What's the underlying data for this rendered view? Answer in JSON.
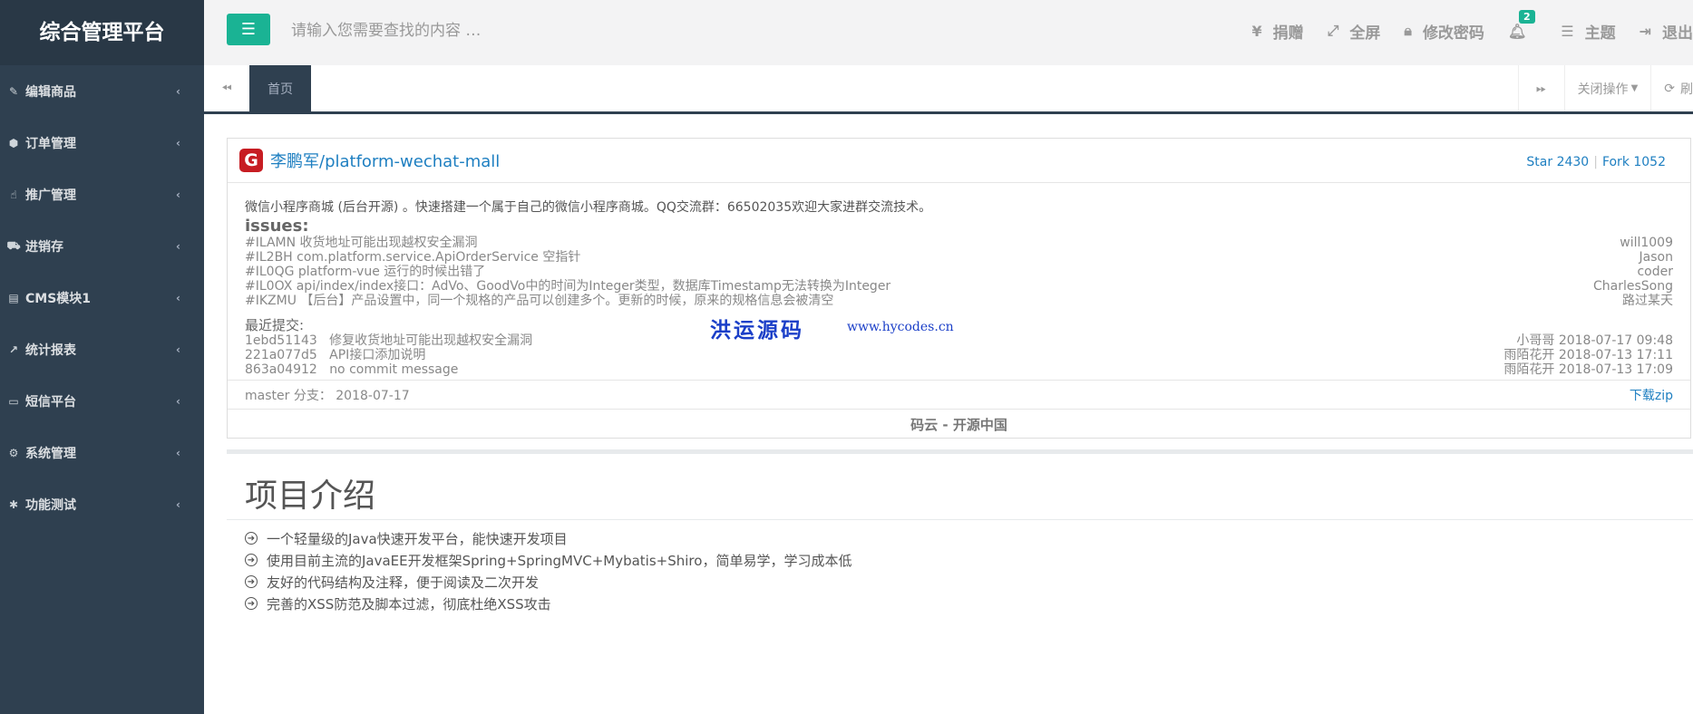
{
  "app": {
    "title": "综合管理平台"
  },
  "sidebar": {
    "items": [
      {
        "label": "编辑商品",
        "icon": "edit-icon"
      },
      {
        "label": "订单管理",
        "icon": "cube-icon"
      },
      {
        "label": "推广管理",
        "icon": "hand-icon"
      },
      {
        "label": "进销存",
        "icon": "truck-icon"
      },
      {
        "label": "CMS模块1",
        "icon": "book-icon"
      },
      {
        "label": "统计报表",
        "icon": "chart-icon"
      },
      {
        "label": "短信平台",
        "icon": "monitor-icon"
      },
      {
        "label": "系统管理",
        "icon": "gear-icon"
      },
      {
        "label": "功能测试",
        "icon": "bug-icon"
      }
    ]
  },
  "topbar": {
    "search_placeholder": "请输入您需要查找的内容 …",
    "donate": "捐赠",
    "fullscreen": "全屏",
    "change_password": "修改密码",
    "notification_count": "2",
    "theme": "主题",
    "logout": "退出"
  },
  "tabs": {
    "home": "首页",
    "close_ops": "关闭操作",
    "refresh": "刷"
  },
  "repo": {
    "name": "李鹏军/platform-wechat-mall",
    "star": "Star 2430",
    "fork": "Fork 1052",
    "description": "微信小程序商城 (后台开源) 。快速搭建一个属于自己的微信小程序商城。QQ交流群：66502035欢迎大家进群交流技术。",
    "issues_title": "issues:",
    "issues": [
      {
        "text": "#ILAMN 收货地址可能出现越权安全漏洞",
        "author": "will1009"
      },
      {
        "text": "#IL2BH com.platform.service.ApiOrderService 空指针",
        "author": "Jason"
      },
      {
        "text": "#IL0QG platform-vue 运行的时候出错了",
        "author": "coder"
      },
      {
        "text": "#IL0OX api/index/index接口：AdVo、GoodVo中的时间为Integer类型，数据库Timestamp无法转换为Integer",
        "author": "CharlesSong"
      },
      {
        "text": "#IKZMU 【后台】产品设置中，同一个规格的产品可以创建多个。更新的时候，原来的规格信息会被清空",
        "author": "路过某天"
      }
    ],
    "commits_title": "最近提交:",
    "commits": [
      {
        "text": "1ebd51143   修复收货地址可能出现越权安全漏洞",
        "meta": "小哥哥 2018-07-17 09:48"
      },
      {
        "text": "221a077d5   API接口添加说明",
        "meta": "雨陌花开 2018-07-13 17:11"
      },
      {
        "text": "863a04912   no commit message",
        "meta": "雨陌花开 2018-07-13 17:09"
      }
    ],
    "branch": "master 分支： 2018-07-17",
    "download": "下载zip",
    "footer": "码云 - 开源中国",
    "watermark": "洪运源码",
    "watermark_url": "www.hycodes.cn"
  },
  "intro": {
    "title": "项目介绍",
    "features": [
      "一个轻量级的Java快速开发平台，能快速开发项目",
      "使用目前主流的JavaEE开发框架Spring+SpringMVC+Mybatis+Shiro，简单易学，学习成本低",
      "友好的代码结构及注释，便于阅读及二次开发",
      "完善的XSS防范及脚本过滤，彻底杜绝XSS攻击"
    ]
  },
  "colors": {
    "sidebar": "#2f4050",
    "accent": "#1ab394",
    "link": "#1e7fc1",
    "watermark": "#1b3fc8"
  }
}
